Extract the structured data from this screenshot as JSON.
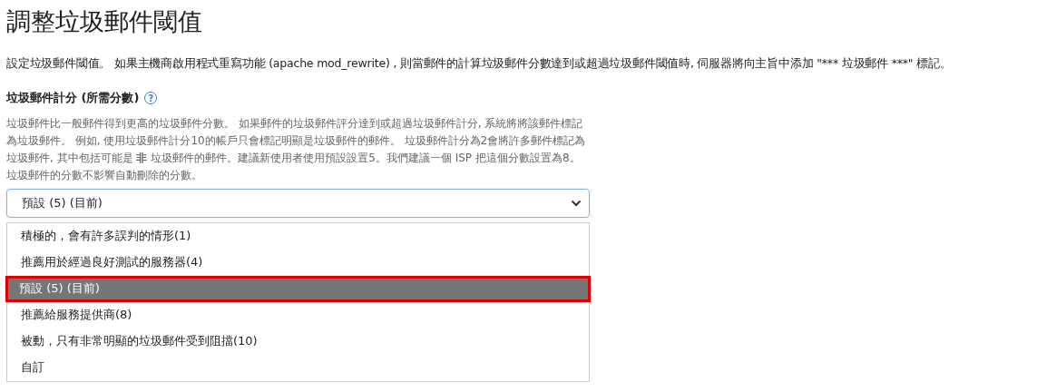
{
  "title": "調整垃圾郵件閾值",
  "intro": "設定垃圾郵件閾值。 如果主機商啟用程式重寫功能 (apache mod_rewrite) , 則當郵件的計算垃圾郵件分數達到或超過垃圾郵件閾值時, 伺服器將向主旨中添加 \"*** 垃圾郵件 ***\" 標記。",
  "field": {
    "label": "垃圾郵件計分 (所需分數)",
    "help": "?",
    "description": "垃圾郵件比一般郵件得到更高的垃圾郵件分數。 如果郵件的垃圾郵件評分達到或超過垃圾郵件計分, 系統將將該郵件標記為垃圾郵件。 例如, 使用垃圾郵件計分10的帳戶只會標記明顯是垃圾郵件的郵件。 垃圾郵件計分為2會將許多郵件標記為垃圾郵件, 其中包括可能是 **非** 垃圾郵件的郵件。建議新使用者使用預設設置5。我們建議一個 ISP 把這個分數設置為8。垃圾郵件的分數不影響自動刪除的分數。",
    "value": "預設 (5) (目前)",
    "expanded": true,
    "options": [
      {
        "label": "積極的，會有許多誤判的情形(1)",
        "selected": false,
        "outlined": false
      },
      {
        "label": "推薦用於經過良好測試的服務器(4)",
        "selected": false,
        "outlined": false
      },
      {
        "label": "預設 (5) (目前)",
        "selected": true,
        "outlined": true
      },
      {
        "label": "推薦給服務提供商(8)",
        "selected": false,
        "outlined": false
      },
      {
        "label": "被動，只有非常明顯的垃圾郵件受到阻擋(10)",
        "selected": false,
        "outlined": false
      },
      {
        "label": "自訂",
        "selected": false,
        "outlined": false
      }
    ]
  }
}
